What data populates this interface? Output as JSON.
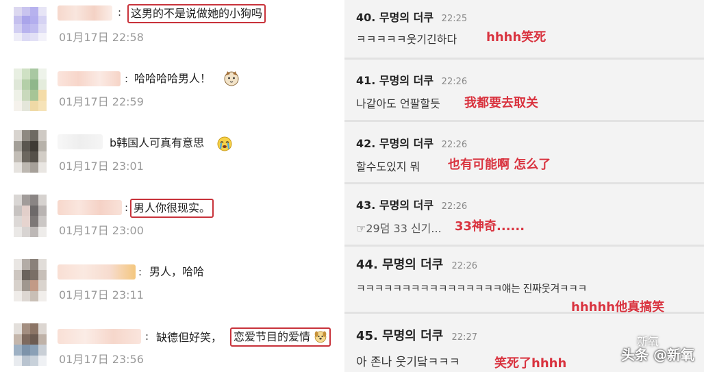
{
  "comments": [
    {
      "text": "这男的不是说做她的小狗吗",
      "time": "01月17日 22:58",
      "boxed": true
    },
    {
      "text": "哈哈哈哈男人！",
      "time": "01月17日 22:59",
      "boxed": false
    },
    {
      "text": "b韩国人可真有意思",
      "time": "01月17日 23:01",
      "boxed": false
    },
    {
      "text": "男人你很现实。",
      "time": "01月17日 23:00",
      "boxed": true
    },
    {
      "text": "男人，哈哈",
      "time": "01月17日 23:11",
      "boxed": false
    },
    {
      "prefix": "缺德但好笑，",
      "text": "恋爱节目的爱情",
      "time": "01月17日 23:56",
      "boxed": true
    }
  ],
  "posts": [
    {
      "num": "40.",
      "user": "무명의 더쿠",
      "time": "22:25",
      "korean": "ㅋㅋㅋㅋㅋ웃기긴하다",
      "chinese": "hhhh笑死"
    },
    {
      "num": "41.",
      "user": "무명의 더쿠",
      "time": "22:26",
      "korean": "나같아도 언팔할듯",
      "chinese": "我都要去取关"
    },
    {
      "num": "42.",
      "user": "무명의 더쿠",
      "time": "22:26",
      "korean": "할수도있지 뭐",
      "chinese": "也有可能啊 怎么了"
    },
    {
      "num": "43.",
      "user": "무명의 더쿠",
      "time": "22:26",
      "korean": "☞29덤 33 신기...",
      "chinese": "33神奇......"
    },
    {
      "num": "44.",
      "user": "무명의 더쿠",
      "time": "22:26",
      "korean": "ㅋㅋㅋㅋㅋㅋㅋㅋㅋㅋㅋㅋㅋㅋㅋㅋ얘는 진짜웃겨ㅋㅋㅋ",
      "chinese": "hhhhh他真搞笑"
    },
    {
      "num": "45.",
      "user": "무명의 더쿠",
      "time": "22:27",
      "korean": "아 존나 웃기닼ㅋㅋㅋ",
      "chinese": "笑死了hhhh"
    }
  ],
  "watermark": {
    "text": "头条 @新氧",
    "small": "新氧"
  },
  "colors": {
    "highlight": "#d9333f",
    "box": "#c8323a"
  }
}
